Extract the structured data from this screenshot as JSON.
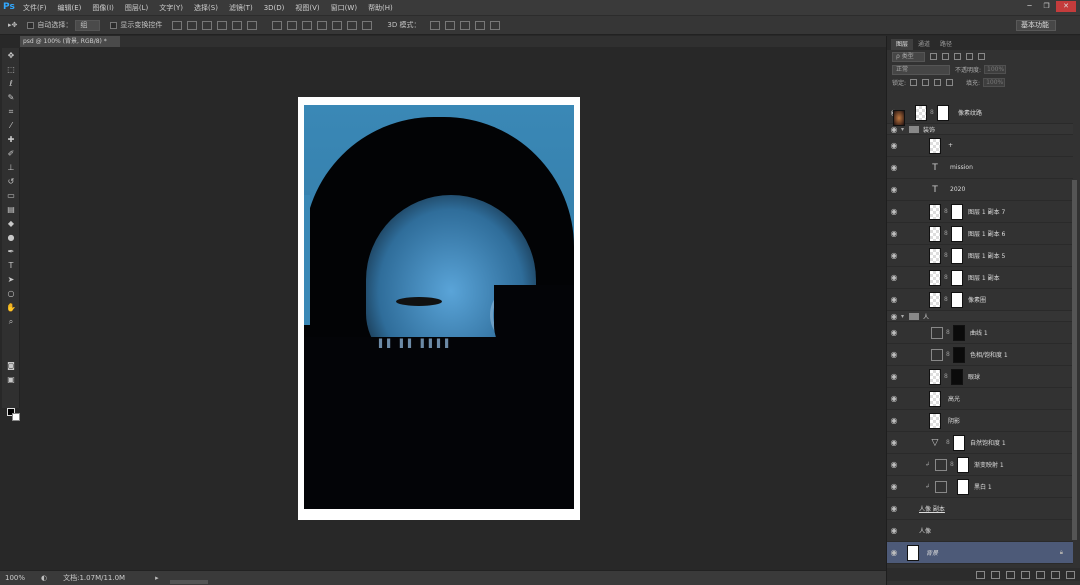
{
  "app": {
    "logo": "Ps"
  },
  "menu": [
    "文件(F)",
    "编辑(E)",
    "图像(I)",
    "图层(L)",
    "文字(Y)",
    "选择(S)",
    "滤镜(T)",
    "3D(D)",
    "视图(V)",
    "窗口(W)",
    "帮助(H)"
  ],
  "options": {
    "auto_select_label": "自动选择：",
    "auto_select_value": "组",
    "show_transform_label": "显示变换控件",
    "mode_3d_label": "3D 模式：",
    "workspace": "基本功能"
  },
  "document": {
    "tab_title": "psd @ 100% (背景, RGB/8) *"
  },
  "status": {
    "zoom": "100%",
    "doc_info": "文档:1.07M/11.0M"
  },
  "overlay_text": {
    "bars": "▌▌ ▌▌ ▌▌▌▌"
  },
  "layers_panel": {
    "tabs": [
      "图层",
      "通道",
      "路径"
    ],
    "filter_kind": "ρ 类型",
    "blend_mode": "正常",
    "opacity_label": "不透明度:",
    "opacity_value": "100%",
    "lock_label": "锁定:",
    "fill_label": "填充:",
    "fill_value": "100%"
  },
  "layers": [
    {
      "name": "像素纹路",
      "kind": "pixel-mask"
    },
    {
      "name": "装饰",
      "kind": "group"
    },
    {
      "name": "+",
      "kind": "pixel"
    },
    {
      "name": "mission",
      "kind": "text"
    },
    {
      "name": "2020",
      "kind": "text"
    },
    {
      "name": "图层 1 副本 7",
      "kind": "pixel-mask"
    },
    {
      "name": "图层 1 副本 6",
      "kind": "pixel-mask"
    },
    {
      "name": "图层 1 副本 5",
      "kind": "pixel-mask"
    },
    {
      "name": "图层 1 副本",
      "kind": "pixel-mask"
    },
    {
      "name": "像素圈",
      "kind": "pixel-mask"
    },
    {
      "name": "人",
      "kind": "group"
    },
    {
      "name": "曲线 1",
      "kind": "adjust-dark"
    },
    {
      "name": "色相/饱和度 1",
      "kind": "adjust-dark"
    },
    {
      "name": "眼球",
      "kind": "pixel-darkmask"
    },
    {
      "name": "高光",
      "kind": "pixel"
    },
    {
      "name": "阴影",
      "kind": "pixel"
    },
    {
      "name": "自然饱和度 1",
      "kind": "adjust"
    },
    {
      "name": "渐变映射 1",
      "kind": "adjust-clip"
    },
    {
      "name": "黑白 1",
      "kind": "adjust-clip"
    },
    {
      "name": "人像 副本",
      "kind": "photo"
    },
    {
      "name": "人像",
      "kind": "photo"
    },
    {
      "name": "背景",
      "kind": "background"
    }
  ]
}
